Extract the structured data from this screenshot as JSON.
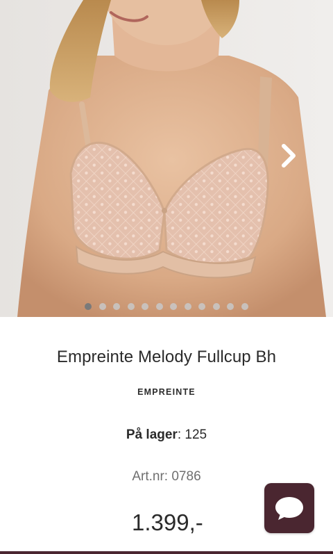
{
  "product": {
    "title": "Empreinte Melody Fullcup Bh",
    "brand": "EMPREINTE",
    "stock_label": "På lager",
    "stock_separator": ": ",
    "stock_value": "125",
    "art_nr": "Art.nr: 0786",
    "price": "1.399,-"
  },
  "gallery": {
    "image_count": 12,
    "active_index": 0,
    "next_icon": "chevron-right-icon",
    "photo_subject": "product-photo"
  },
  "chat": {
    "icon": "chat-bubble-icon"
  },
  "colors": {
    "accent": "#4a2630",
    "active_dot": "#7a7a7a",
    "inactive_dot": "#c8c8c8",
    "text": "#2a2a2a",
    "muted_text": "#6f6f6f"
  }
}
